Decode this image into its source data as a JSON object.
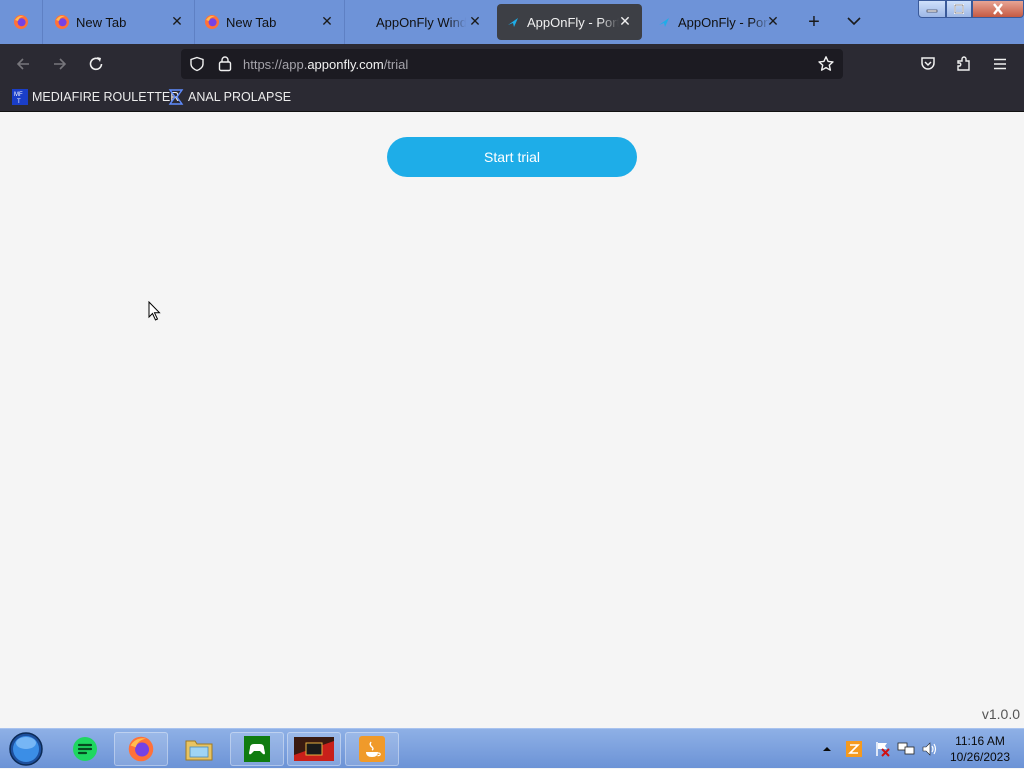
{
  "browser": {
    "tabs": [
      {
        "label": "",
        "type": "pinned",
        "icon": "firefox-icon"
      },
      {
        "label": "New Tab",
        "icon": "firefox-icon"
      },
      {
        "label": "New Tab",
        "icon": "firefox-icon"
      },
      {
        "label": "AppOnFly Windows",
        "icon": "none"
      },
      {
        "label": "AppOnFly - Portal",
        "icon": "apponfly-icon",
        "active": true
      },
      {
        "label": "AppOnFly - Portal",
        "icon": "apponfly-icon"
      }
    ],
    "url": {
      "prefix": "https://app.",
      "host": "apponfly.com",
      "path": "/trial"
    },
    "bookmarks": [
      {
        "label": "MEDIAFIRE ROULETTER",
        "icon": "mediafire-icon"
      },
      {
        "label": "ANAL PROLAPSE",
        "icon": "sigma-icon"
      }
    ]
  },
  "page": {
    "start_button": "Start trial",
    "version": "v1.0.0"
  },
  "taskbar": {
    "apps": [
      "spotify-icon",
      "firefox-icon",
      "file-explorer-icon",
      "xbox-icon",
      "game-icon",
      "java-icon"
    ],
    "clock_time": "11:16 AM",
    "clock_date": "10/26/2023"
  },
  "colors": {
    "tabstrip": "#6e93d8",
    "toolbar": "#2b2a33",
    "accent_button": "#1eade8",
    "page_bg": "#f5f5f5"
  }
}
